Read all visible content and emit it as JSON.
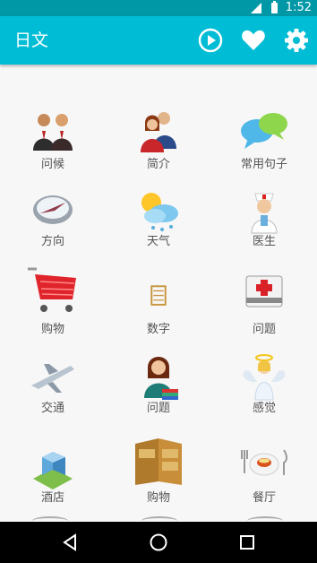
{
  "status_bar": {
    "time": "1:52",
    "network": "3G"
  },
  "app_bar": {
    "title": "日文",
    "icons": [
      "play-icon",
      "heart-icon",
      "gear-icon"
    ]
  },
  "colors": {
    "primary": "#00bcd4",
    "primary_dark": "#0097a7",
    "background": "#f7f7f7",
    "label": "#555555"
  },
  "grid": {
    "items": [
      {
        "label": "问候",
        "icon": "greeting-people-icon"
      },
      {
        "label": "简介",
        "icon": "introduction-people-icon"
      },
      {
        "label": "常用句子",
        "icon": "speech-bubbles-icon"
      },
      {
        "label": "方向",
        "icon": "compass-icon"
      },
      {
        "label": "天气",
        "icon": "weather-icon"
      },
      {
        "label": "医生",
        "icon": "doctor-icon"
      },
      {
        "label": "购物",
        "icon": "shopping-cart-icon"
      },
      {
        "label": "数字",
        "icon": "abacus-icon"
      },
      {
        "label": "问题",
        "icon": "first-aid-kit-icon"
      },
      {
        "label": "交通",
        "icon": "airplane-icon"
      },
      {
        "label": "问题",
        "icon": "reading-person-icon"
      },
      {
        "label": "感觉",
        "icon": "angel-icon"
      },
      {
        "label": "酒店",
        "icon": "hotel-building-icon"
      },
      {
        "label": "购物",
        "icon": "wallet-icon"
      },
      {
        "label": "餐厅",
        "icon": "dining-plate-icon"
      }
    ]
  },
  "nav_bar": {
    "icons": [
      "back-icon",
      "home-icon",
      "recents-icon"
    ]
  }
}
